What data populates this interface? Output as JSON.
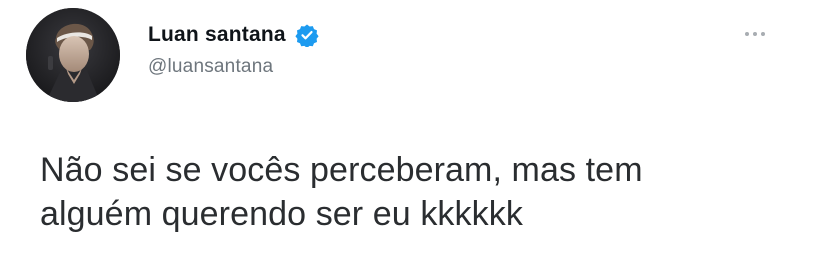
{
  "tweet": {
    "author": {
      "display_name": "Luan santana",
      "handle": "@luansantana",
      "verified": true,
      "verified_color": "#1d9bf0"
    },
    "more_icon": "more-options-icon",
    "text_lines": [
      "Não sei se vocês perceberam, mas tem",
      "alguém querendo ser eu kkkkkk"
    ]
  }
}
